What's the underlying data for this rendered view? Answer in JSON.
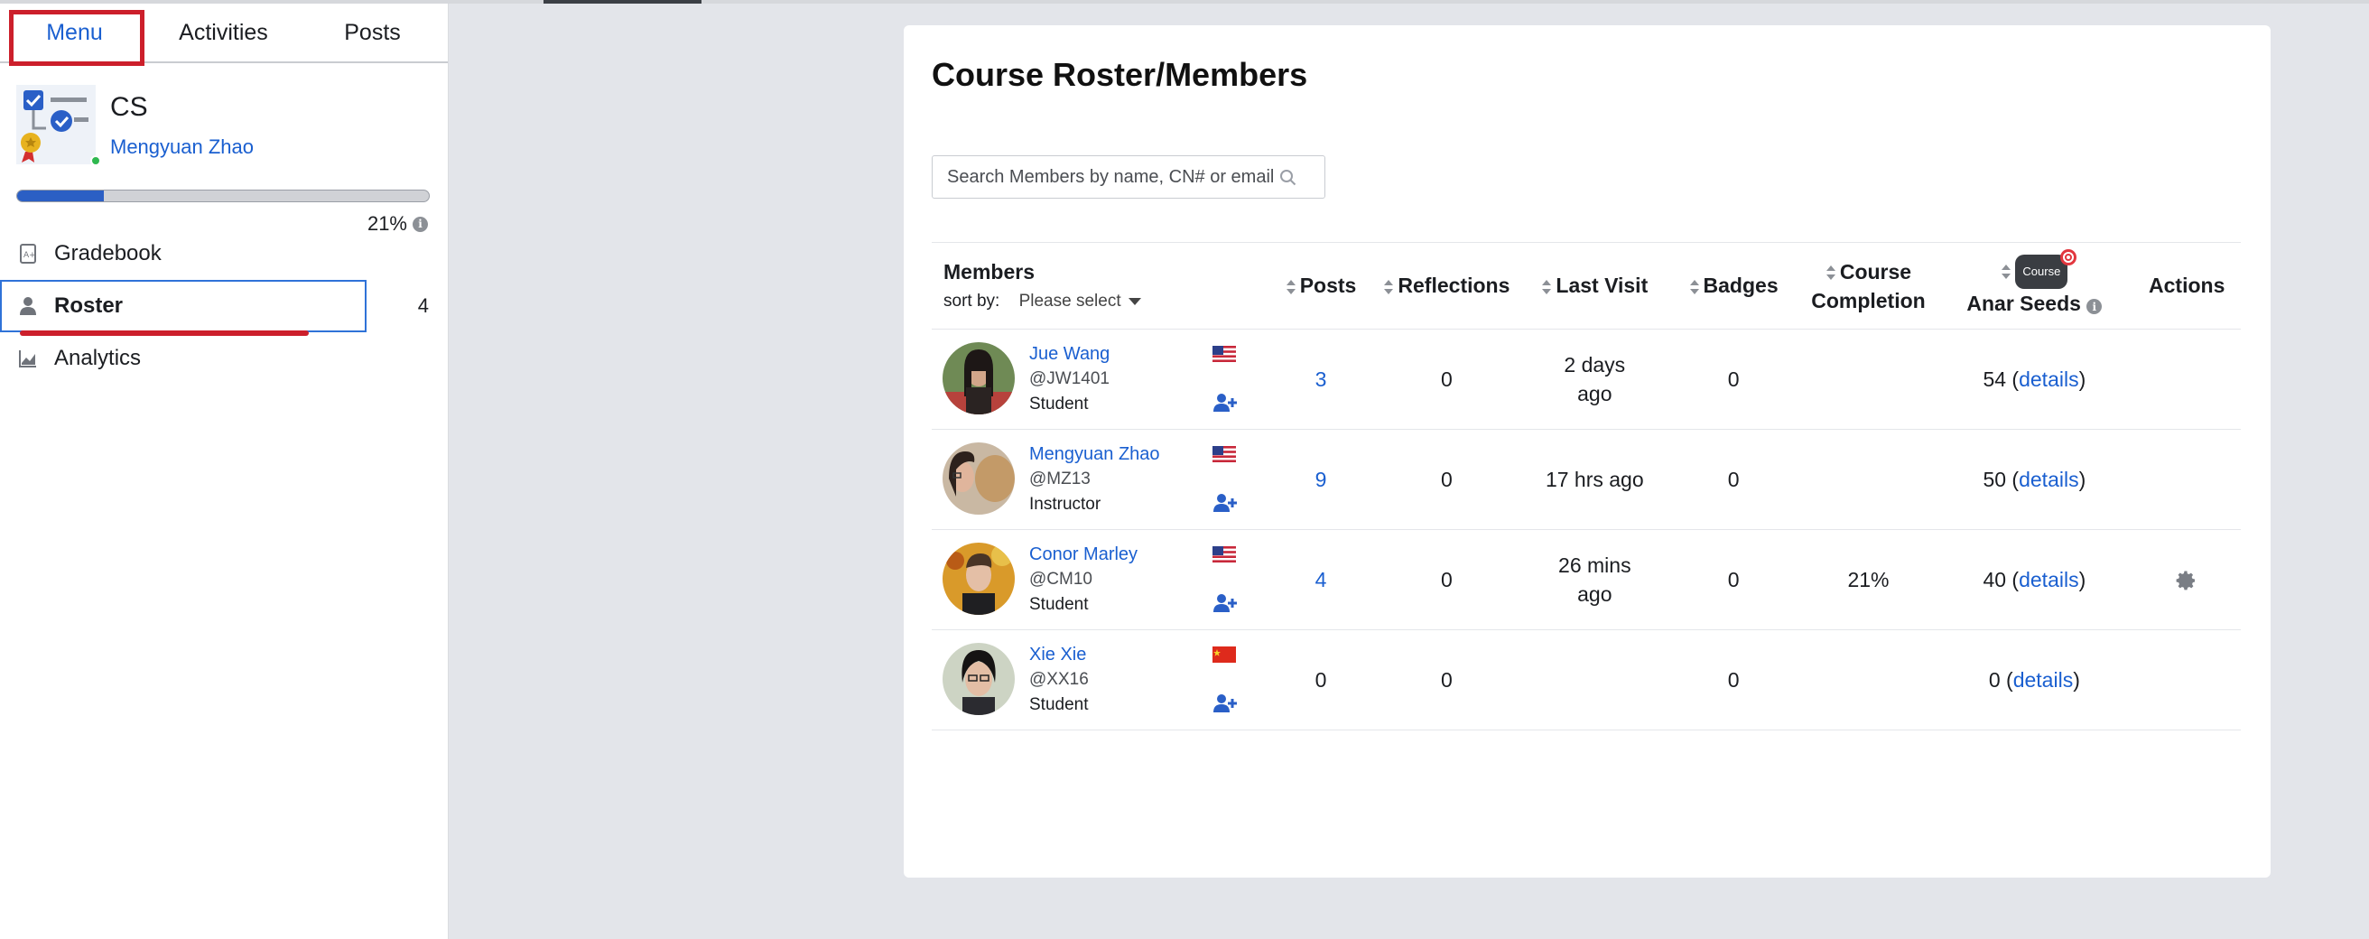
{
  "sidebar": {
    "tabs": [
      {
        "label": "Menu"
      },
      {
        "label": "Activities"
      },
      {
        "label": "Posts"
      }
    ],
    "course": {
      "name": "CS",
      "user": "Mengyuan Zhao"
    },
    "progress": {
      "percent": 21,
      "label": "21%"
    },
    "nav": [
      {
        "label": "Gradebook",
        "icon": "gradebook-icon"
      },
      {
        "label": "Roster",
        "icon": "person-icon",
        "count": "4",
        "active": true
      },
      {
        "label": "Analytics",
        "icon": "chart-icon"
      }
    ]
  },
  "main": {
    "title": "Course Roster/Members",
    "search": {
      "placeholder": "Search Members by name, CN# or email",
      "value": ""
    },
    "table": {
      "headers": {
        "members": "Members",
        "sort_by": "sort by:",
        "sort_select": "Please select",
        "posts": "Posts",
        "reflections": "Reflections",
        "last_visit": "Last Visit",
        "badges": "Badges",
        "completion_1": "Course",
        "completion_2": "Completion",
        "seeds_badge": "Course",
        "seeds": "Anar Seeds",
        "actions": "Actions"
      },
      "details_label": "details",
      "rows": [
        {
          "name": "Jue Wang",
          "handle": "@JW1401",
          "role": "Student",
          "flag": "us",
          "posts": "3",
          "posts_link": true,
          "reflections": "0",
          "last_visit": "2 days ago",
          "badges": "0",
          "completion": "",
          "seeds": "54",
          "gear": false
        },
        {
          "name": "Mengyuan Zhao",
          "handle": "@MZ13",
          "role": "Instructor",
          "flag": "us",
          "posts": "9",
          "posts_link": true,
          "reflections": "0",
          "last_visit": "17 hrs ago",
          "badges": "0",
          "completion": "",
          "seeds": "50",
          "gear": false
        },
        {
          "name": "Conor Marley",
          "handle": "@CM10",
          "role": "Student",
          "flag": "us",
          "posts": "4",
          "posts_link": true,
          "reflections": "0",
          "last_visit": "26 mins ago",
          "badges": "0",
          "completion": "21%",
          "seeds": "40",
          "gear": true
        },
        {
          "name": "Xie Xie",
          "handle": "@XX16",
          "role": "Student",
          "flag": "cn",
          "posts": "0",
          "posts_link": false,
          "reflections": "0",
          "last_visit": "",
          "badges": "0",
          "completion": "",
          "seeds": "0",
          "gear": false
        }
      ]
    }
  },
  "colors": {
    "accent": "#1a5fd0",
    "highlight": "#cc1f2b",
    "progress": "#2b5fc4"
  }
}
